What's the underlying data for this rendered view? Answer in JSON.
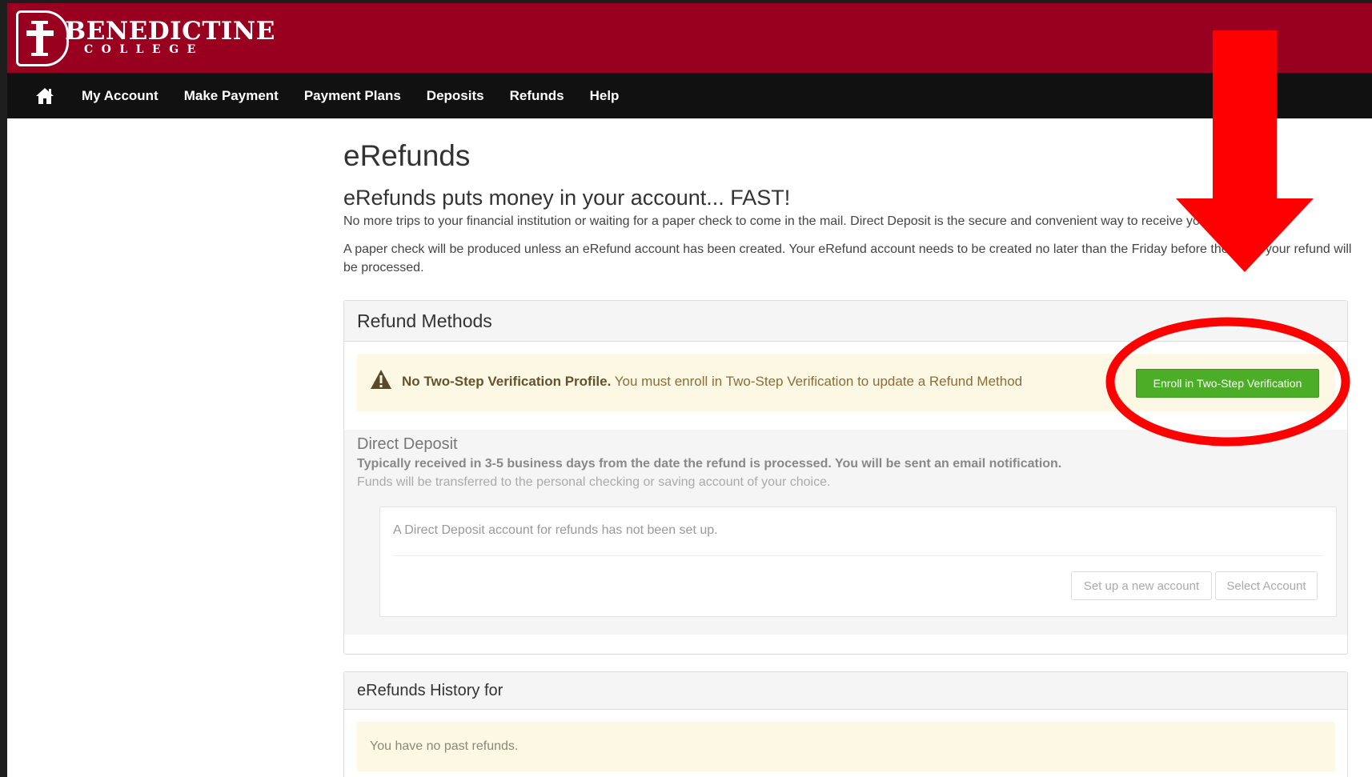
{
  "brand": {
    "name_line1": "BENEDICTINE",
    "name_line2": "COLLEGE",
    "color": "#99001f"
  },
  "nav": {
    "home_icon": "home-icon",
    "items": [
      "My Account",
      "Make Payment",
      "Payment Plans",
      "Deposits",
      "Refunds",
      "Help"
    ]
  },
  "page": {
    "title": "eRefunds",
    "subheading": "eRefunds puts money in your account... FAST!",
    "para1": "No more trips to your financial institution or waiting for a paper check to come in the mail. Direct Deposit is the secure and convenient way to receive your refund.",
    "para2": "A paper check will be produced unless an eRefund account has been created. Your eRefund account needs to be created no later than the Friday before the week your refund will be processed."
  },
  "refund_methods": {
    "heading": "Refund Methods",
    "warning_icon": "warning-triangle-icon",
    "warning_bold": "No Two-Step Verification Profile.",
    "warning_text": "You must enroll in Two-Step Verification to update a Refund Method",
    "enroll_label": "Enroll in Two-Step Verification",
    "enroll_color": "#4cae26"
  },
  "direct_deposit": {
    "title": "Direct Deposit",
    "strong_text": "Typically received in 3-5 business days from the date the refund is processed. You will be sent an email notification.",
    "muted_text": "Funds will be transferred to the personal checking or saving account of your choice.",
    "status_message": "A Direct Deposit account for refunds has not been set up.",
    "setup_label": "Set up a new account",
    "select_label": "Select Account"
  },
  "history": {
    "heading": "eRefunds History for",
    "empty_message": "You have no past refunds."
  },
  "annotation": {
    "color": "#ff0000",
    "arrow_icon": "down-arrow-icon",
    "circle_icon": "highlight-ellipse-icon"
  }
}
